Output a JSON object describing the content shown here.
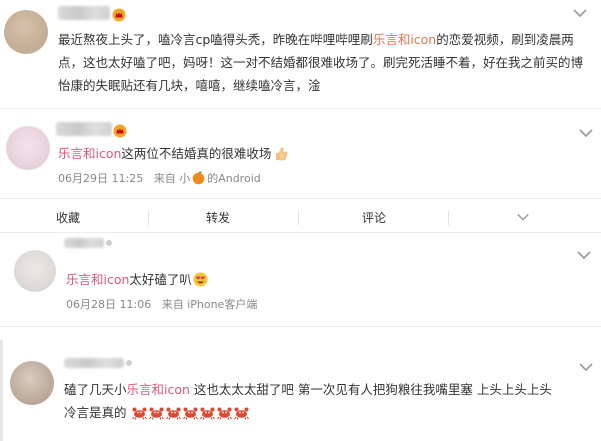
{
  "post": {
    "line1_a": "最近熬夜上头了，嗑冷言cp嗑得头秃，昨晚在哔哩哔哩刷",
    "line1_highlight": "乐言和icon",
    "line1_b": "的恋爱视频，刷到凌晨两",
    "line2": "点，这也太好嗑了吧，妈呀！这一对不结婚都很难收场了。刷完死活睡不着，好在我之前买的博",
    "line3": "怡康的失眠贴还有几块，嘻嘻，继续嗑冷言，淦"
  },
  "comment1": {
    "highlight": "乐言和icon",
    "text": "这两位不结婚真的很难收场",
    "date": "06月29日 11:25",
    "source_prefix": "来自 小",
    "source_suffix": "的Android"
  },
  "actions": {
    "collect": "收藏",
    "repost": "转发",
    "comment": "评论"
  },
  "comment2": {
    "highlight": "乐言和icon",
    "text": "太好磕了叭",
    "date": "06月28日 11:06",
    "source": "来自 iPhone客户端"
  },
  "comment3": {
    "line1_a": "磕了几天小",
    "line1_highlight": "乐言和icon",
    "line1_b": " 这也太太太甜了吧 第一次见有人把狗粮往我嘴里塞 上头上头上头",
    "line2": "冷言是真的"
  },
  "colors": {
    "highlight": "#eb7350",
    "meta": "#888888",
    "divider": "#ececec"
  },
  "icons": [
    "chevron-down-icon",
    "vip-crown-icon",
    "thumbs-up-icon",
    "heart-eyes-icon",
    "crab-icon",
    "orange-icon"
  ]
}
